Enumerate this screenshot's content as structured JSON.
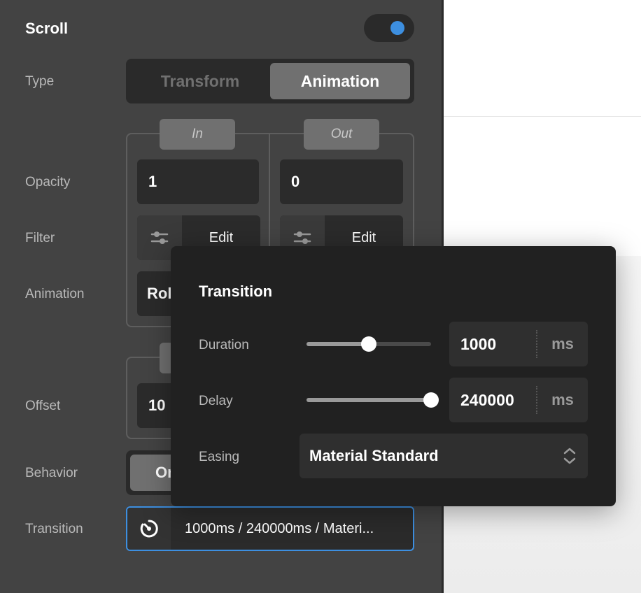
{
  "panel": {
    "title": "Scroll",
    "toggle_on": true,
    "rows": {
      "type": "Type",
      "opacity": "Opacity",
      "filter": "Filter",
      "animation": "Animation",
      "offset": "Offset",
      "behavior": "Behavior",
      "transition": "Transition"
    },
    "type_options": [
      "Transform",
      "Animation"
    ],
    "type_selected": "Animation",
    "in_tag": "In",
    "out_tag": "Out",
    "opacity_in": "1",
    "opacity_out": "0",
    "filter_edit_label": "Edit",
    "animation_in_visible": "Rol",
    "offset_visible": "10",
    "behavior_visible": "On",
    "transition_summary": "1000ms / 240000ms / Materi..."
  },
  "popup": {
    "title": "Transition",
    "duration_label": "Duration",
    "duration_value": "1000",
    "duration_slider": 0.5,
    "delay_label": "Delay",
    "delay_value": "240000",
    "delay_slider": 1.0,
    "unit": "ms",
    "easing_label": "Easing",
    "easing_value": "Material Standard"
  },
  "colors": {
    "panel_bg": "#434343",
    "accent": "#3d8fe0",
    "popup_bg": "#212121"
  }
}
